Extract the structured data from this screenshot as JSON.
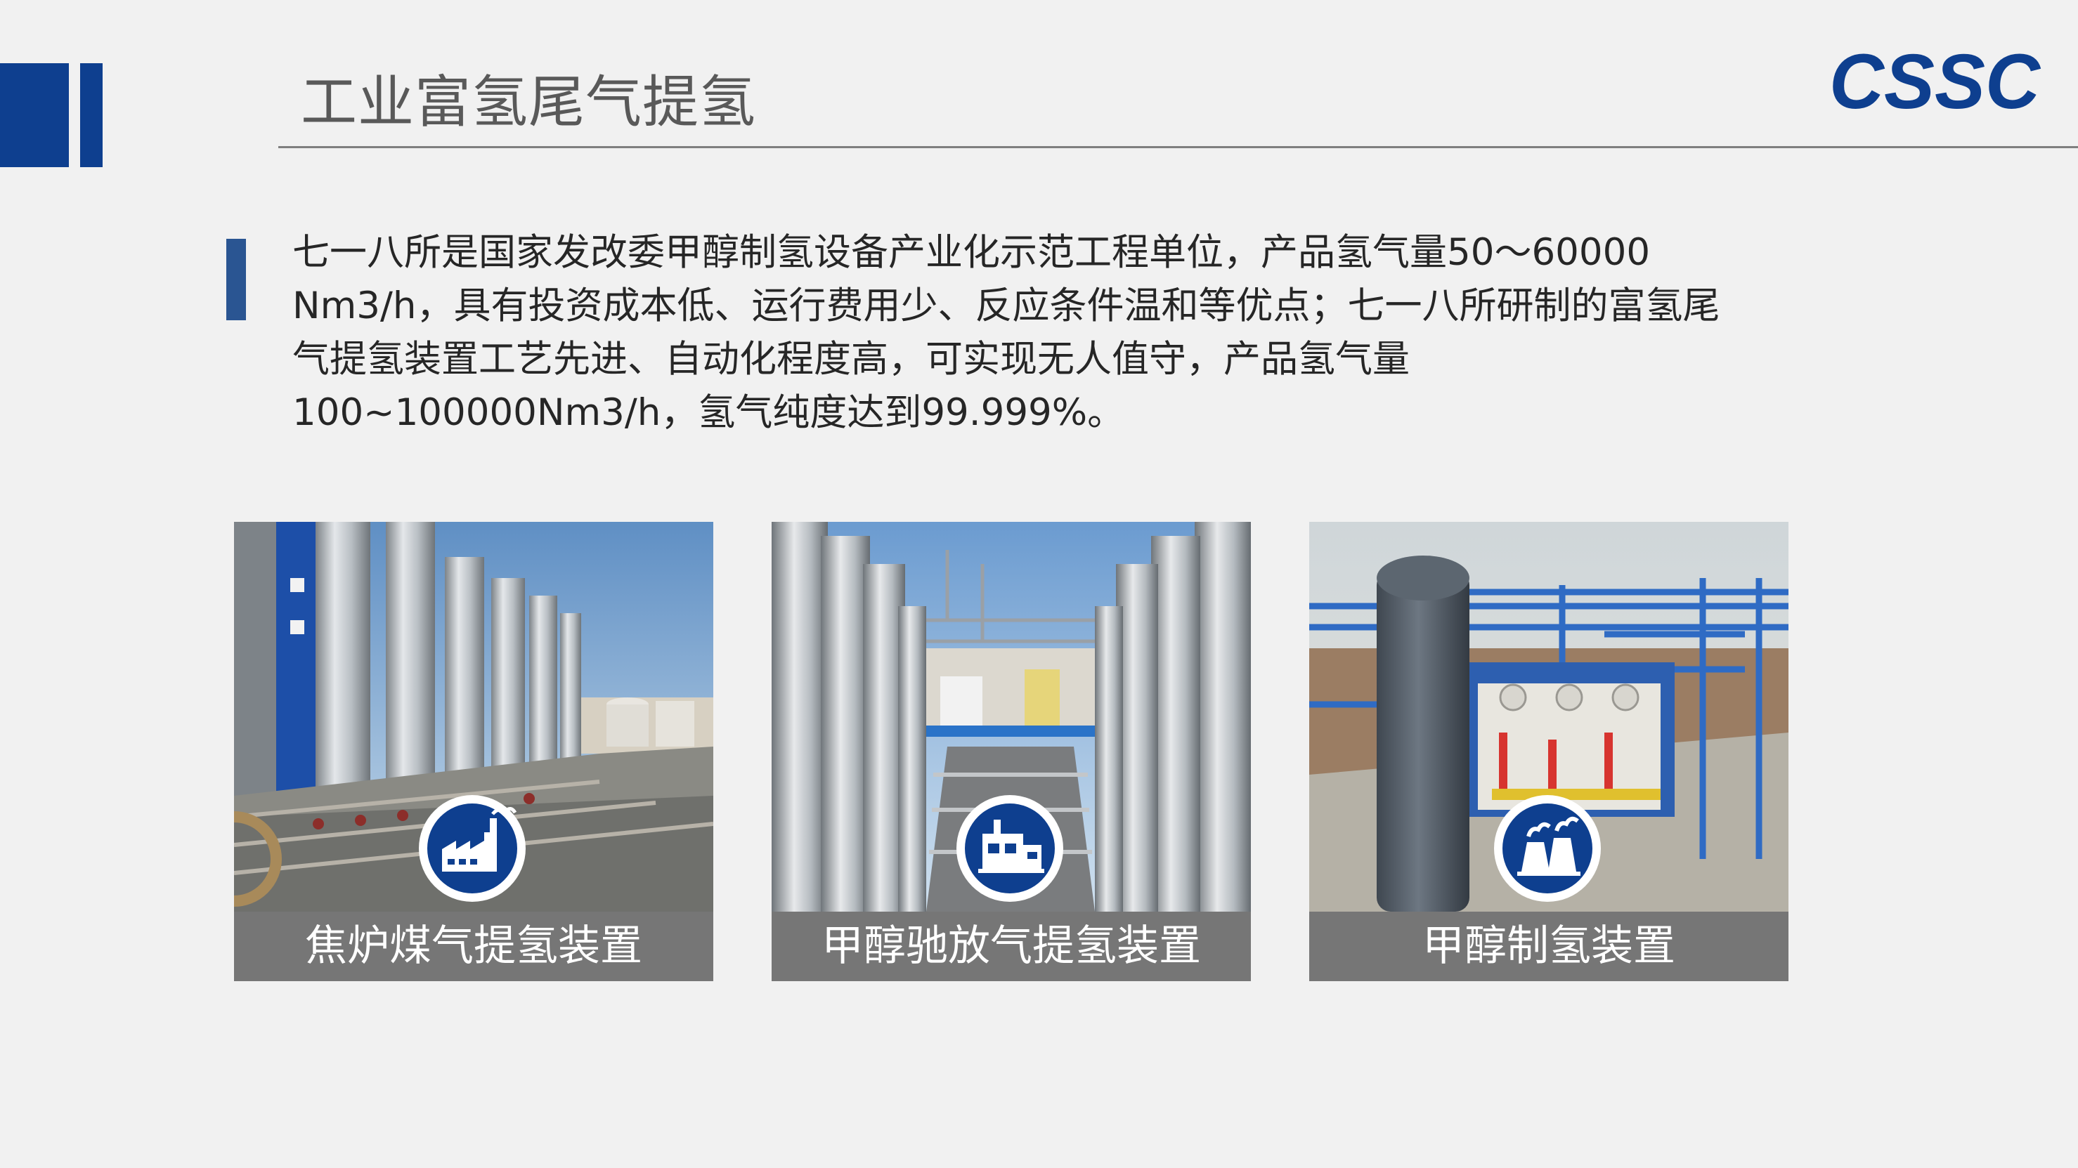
{
  "page": {
    "title": "工业富氢尾气提氢",
    "logo_text": "CSSC",
    "intro": "七一八所是国家发改委甲醇制氢设备产业化示范工程单位，产品氢气量50～60000 Nm3/h，具有投资成本低、运行费用少、反应条件温和等优点；七一八所研制的富氢尾气提氢装置工艺先进、自动化程度高，可实现无人值守，产品氢气量100~100000Nm3/h，氢气纯度达到99.999%。"
  },
  "cards": [
    {
      "caption": "焦炉煤气提氢装置",
      "icon": "factory-icon"
    },
    {
      "caption": "甲醇驰放气提氢装置",
      "icon": "plant-building-icon"
    },
    {
      "caption": "甲醇制氢装置",
      "icon": "cooling-towers-icon"
    }
  ],
  "colors": {
    "brand_blue": "#0e3f8f",
    "accent_blue": "#2a5592",
    "caption_gray": "#767676",
    "background": "#f1f1f1"
  }
}
